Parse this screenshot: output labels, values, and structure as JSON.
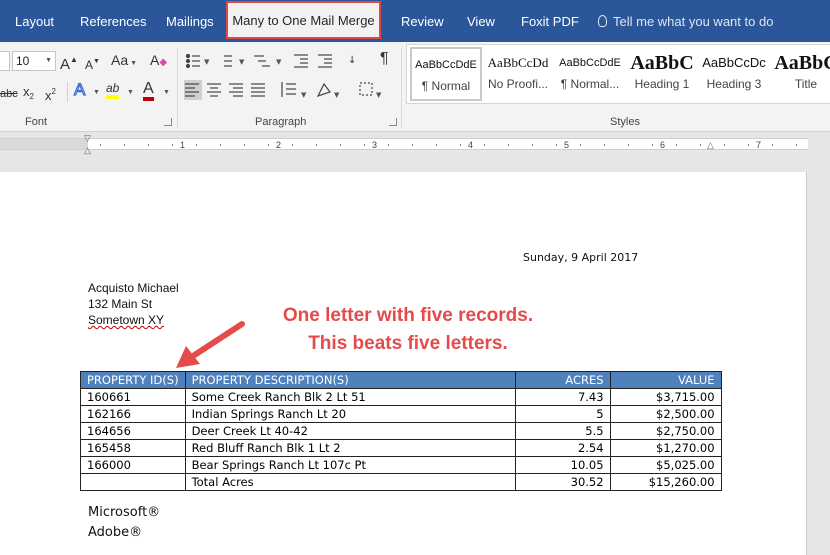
{
  "tabs": {
    "layout": "Layout",
    "references": "References",
    "mailings": "Mailings",
    "custom": "Many to One Mail Merge",
    "review": "Review",
    "view": "View",
    "foxit": "Foxit PDF",
    "tell_me": "Tell me what you want to do"
  },
  "ribbon": {
    "font_size": "10",
    "grow": "A",
    "shrink": "A",
    "case": "Aa",
    "clear": "A",
    "strike": "abc",
    "subscript": "x",
    "superscript": "x",
    "effects": "A",
    "highlight": "ab",
    "font_color": "A",
    "pilcrow": "¶",
    "font_group": "Font",
    "paragraph_group": "Paragraph",
    "styles_group": "Styles",
    "styles": [
      {
        "preview": "AaBbCcDdE",
        "name": "¶ Normal"
      },
      {
        "preview": "AaBbCcDd",
        "name": "No Proofi..."
      },
      {
        "preview": "AaBbCcDdE",
        "name": "¶ Normal..."
      },
      {
        "preview": "AaBbC",
        "name": "Heading 1"
      },
      {
        "preview": "AaBbCcDc",
        "name": "Heading 3"
      },
      {
        "preview": "AaBbC",
        "name": "Title"
      }
    ]
  },
  "ruler": [
    "1",
    "2",
    "3",
    "4",
    "5",
    "6",
    "7"
  ],
  "doc": {
    "date": "Sunday, 9 April 2017",
    "address": [
      "Acquisto Michael",
      "132 Main St",
      "Sometown XY"
    ],
    "annotation": [
      "One letter with five records.",
      "This beats five letters."
    ],
    "table": {
      "headers": [
        "PROPERTY ID(S)",
        "PROPERTY DESCRIPTION(S)",
        "ACRES",
        "VALUE"
      ],
      "rows": [
        [
          "160661",
          "Some Creek Ranch Blk 2 Lt 51",
          "7.43",
          "$3,715.00"
        ],
        [
          "162166",
          "Indian Springs Ranch  Lt 20",
          "5",
          "$2,500.00"
        ],
        [
          "164656",
          "Deer Creek  Lt 40-42",
          "5.5",
          "$2,750.00"
        ],
        [
          "165458",
          "Red Bluff Ranch Blk 1 Lt 2",
          "2.54",
          "$1,270.00"
        ],
        [
          "166000",
          "Bear Springs Ranch  Lt 107c Pt",
          "10.05",
          "$5,025.00"
        ]
      ],
      "total": [
        "",
        "Total Acres",
        "30.52",
        "$15,260.00"
      ]
    },
    "footer": [
      "Microsoft®",
      "Adobe®"
    ]
  },
  "colors": {
    "ribbon_blue": "#2b579a",
    "table_header": "#4f81bd",
    "annotation": "#e54b4b",
    "tab_highlight_border": "#e04848"
  }
}
